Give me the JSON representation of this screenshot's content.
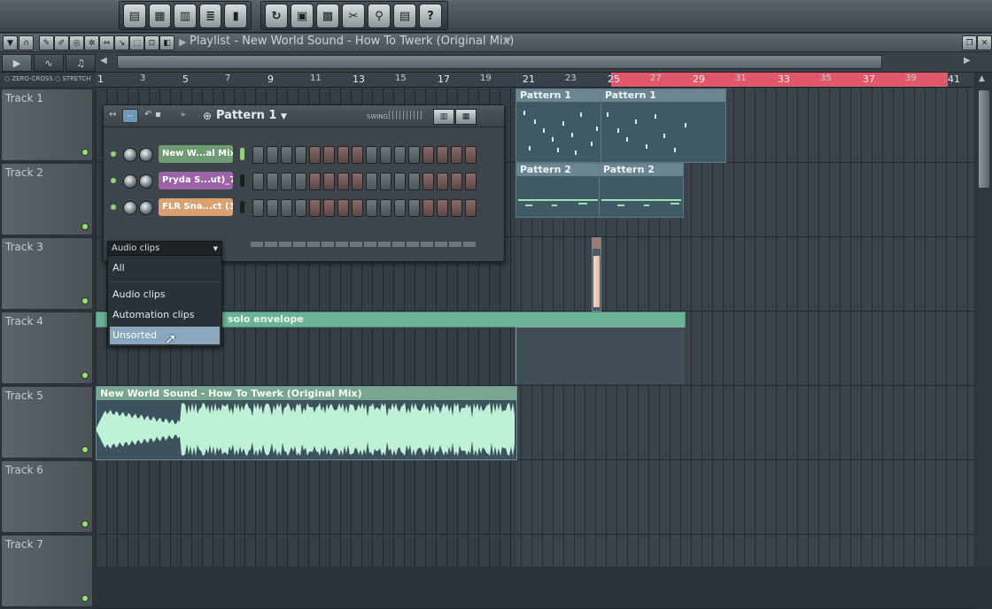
{
  "window": {
    "title": "Playlist - New World Sound - How To Twerk (Original Mix)"
  },
  "toolbar": {
    "group1_icons": [
      "playlist-icon",
      "piano-roll-icon",
      "keyboard-icon",
      "browser-icon",
      "mixer-icon"
    ],
    "group2_icons": [
      "undo-icon",
      "save-icon",
      "render-icon",
      "cut-icon",
      "zoom-icon",
      "notes-icon",
      "help-icon"
    ],
    "help_label": "?"
  },
  "secondary_bar": {
    "zero_cross_label": "ZERO-CROSS",
    "stretch_label": "STRETCH"
  },
  "ruler": {
    "bars": [
      "1",
      "3",
      "5",
      "7",
      "9",
      "11",
      "13",
      "15",
      "17",
      "19",
      "21",
      "23",
      "25",
      "27",
      "29",
      "31",
      "33",
      "35",
      "37",
      "39",
      "41"
    ],
    "loop_color": "#e0596a"
  },
  "tracks": [
    {
      "label": "Track 1"
    },
    {
      "label": "Track 2"
    },
    {
      "label": "Track 3"
    },
    {
      "label": "Track 4"
    },
    {
      "label": "Track 5"
    },
    {
      "label": "Track 6"
    },
    {
      "label": "Track 7"
    }
  ],
  "clips": {
    "pattern1_a": "Pattern 1",
    "pattern1_b": "Pattern 1",
    "pattern2_a": "Pattern 2",
    "pattern2_b": "Pattern 2",
    "automation": "solo envelope",
    "audio": "New World Sound - How To Twerk (Original Mix)"
  },
  "channel_rack": {
    "pattern_label": "Pattern 1",
    "swing_label": "SWING",
    "channels": [
      {
        "name": "New W...al Mix)",
        "color": "#6f9c73"
      },
      {
        "name": "Pryda S...ut)_70",
        "color": "#9c64a8"
      },
      {
        "name": "FLR Sna...ct (3)",
        "color": "#d9a070"
      }
    ],
    "filter_selected": "Audio clips"
  },
  "filter_menu": {
    "items": [
      "All",
      "Audio clips",
      "Automation clips",
      "Unsorted"
    ]
  }
}
